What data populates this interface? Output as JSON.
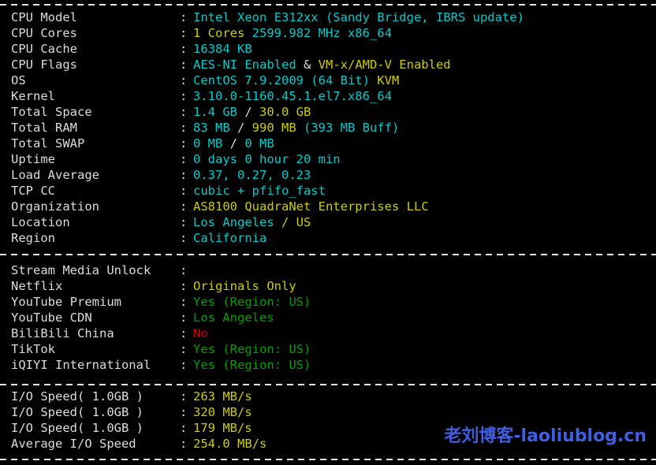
{
  "terminal": {
    "background": "#000000",
    "label_color": "#dcdcdc",
    "colors": {
      "cyan": "#00cdcd",
      "yellow": "#cdcd00",
      "green": "#00a000",
      "red": "#cd0000",
      "white": "#dcdcdc",
      "watermark": "#3f5fe0"
    },
    "colon": ":"
  },
  "watermark": {
    "text": "老刘博客-laoliublog.cn"
  },
  "system": {
    "rows": [
      {
        "label": "CPU Model",
        "parts": [
          {
            "text": "Intel Xeon E312xx (Sandy Bridge, IBRS update)",
            "color": "cyan"
          }
        ]
      },
      {
        "label": "CPU Cores",
        "parts": [
          {
            "text": "1 Cores ",
            "color": "yellow"
          },
          {
            "text": "2599.982 MHz x86_64",
            "color": "cyan"
          }
        ]
      },
      {
        "label": "CPU Cache",
        "parts": [
          {
            "text": "16384 KB",
            "color": "cyan"
          }
        ]
      },
      {
        "label": "CPU Flags",
        "parts": [
          {
            "text": "AES-NI Enabled",
            "color": "cyan"
          },
          {
            "text": " & ",
            "color": "white"
          },
          {
            "text": "VM-x/AMD-V Enabled",
            "color": "yellow"
          }
        ]
      },
      {
        "label": "OS",
        "parts": [
          {
            "text": "CentOS 7.9.2009 (64 Bit) ",
            "color": "cyan"
          },
          {
            "text": "KVM",
            "color": "yellow"
          }
        ]
      },
      {
        "label": "Kernel",
        "parts": [
          {
            "text": "3.10.0-1160.45.1.el7.x86_64",
            "color": "cyan"
          }
        ]
      },
      {
        "label": "Total Space",
        "parts": [
          {
            "text": "1.4 GB ",
            "color": "cyan"
          },
          {
            "text": "/ ",
            "color": "white"
          },
          {
            "text": "30.0 GB",
            "color": "yellow"
          }
        ]
      },
      {
        "label": "Total RAM",
        "parts": [
          {
            "text": "83 MB ",
            "color": "cyan"
          },
          {
            "text": "/ ",
            "color": "white"
          },
          {
            "text": "990 MB ",
            "color": "yellow"
          },
          {
            "text": "(393 MB Buff)",
            "color": "cyan"
          }
        ]
      },
      {
        "label": "Total SWAP",
        "parts": [
          {
            "text": "0 MB ",
            "color": "cyan"
          },
          {
            "text": "/ ",
            "color": "white"
          },
          {
            "text": "0 MB",
            "color": "cyan"
          }
        ]
      },
      {
        "label": "Uptime",
        "parts": [
          {
            "text": "0 days 0 hour 20 min",
            "color": "cyan"
          }
        ]
      },
      {
        "label": "Load Average",
        "parts": [
          {
            "text": "0.37, 0.27, 0.23",
            "color": "cyan"
          }
        ]
      },
      {
        "label": "TCP CC",
        "parts": [
          {
            "text": "cubic + pfifo_fast",
            "color": "cyan"
          }
        ]
      },
      {
        "label": "Organization",
        "parts": [
          {
            "text": "AS8100 QuadraNet Enterprises LLC",
            "color": "yellow"
          }
        ]
      },
      {
        "label": "Location",
        "parts": [
          {
            "text": "Los Angeles ",
            "color": "cyan"
          },
          {
            "text": "/ US",
            "color": "yellow"
          }
        ]
      },
      {
        "label": "Region",
        "parts": [
          {
            "text": "California",
            "color": "cyan"
          }
        ]
      }
    ]
  },
  "stream_media": {
    "rows": [
      {
        "label": "Stream Media Unlock",
        "parts": []
      },
      {
        "label": "Netflix",
        "parts": [
          {
            "text": "Originals Only",
            "color": "yellow"
          }
        ]
      },
      {
        "label": "YouTube Premium",
        "parts": [
          {
            "text": "Yes (Region: US)",
            "color": "green"
          }
        ]
      },
      {
        "label": "YouTube CDN",
        "parts": [
          {
            "text": "Los Angeles",
            "color": "green"
          }
        ]
      },
      {
        "label": "BiliBili China",
        "parts": [
          {
            "text": "No",
            "color": "red"
          }
        ]
      },
      {
        "label": "TikTok",
        "parts": [
          {
            "text": "Yes (Region: US)",
            "color": "green"
          }
        ]
      },
      {
        "label": "iQIYI International",
        "parts": [
          {
            "text": "Yes (Region: US)",
            "color": "green"
          }
        ]
      }
    ]
  },
  "io_speed": {
    "rows": [
      {
        "label": "I/O Speed( 1.0GB )",
        "parts": [
          {
            "text": "263 MB/s",
            "color": "yellow"
          }
        ]
      },
      {
        "label": "I/O Speed( 1.0GB )",
        "parts": [
          {
            "text": "320 MB/s",
            "color": "yellow"
          }
        ]
      },
      {
        "label": "I/O Speed( 1.0GB )",
        "parts": [
          {
            "text": "179 MB/s",
            "color": "yellow"
          }
        ]
      },
      {
        "label": "Average I/O Speed",
        "parts": [
          {
            "text": "254.0 MB/s",
            "color": "yellow"
          }
        ]
      }
    ]
  }
}
